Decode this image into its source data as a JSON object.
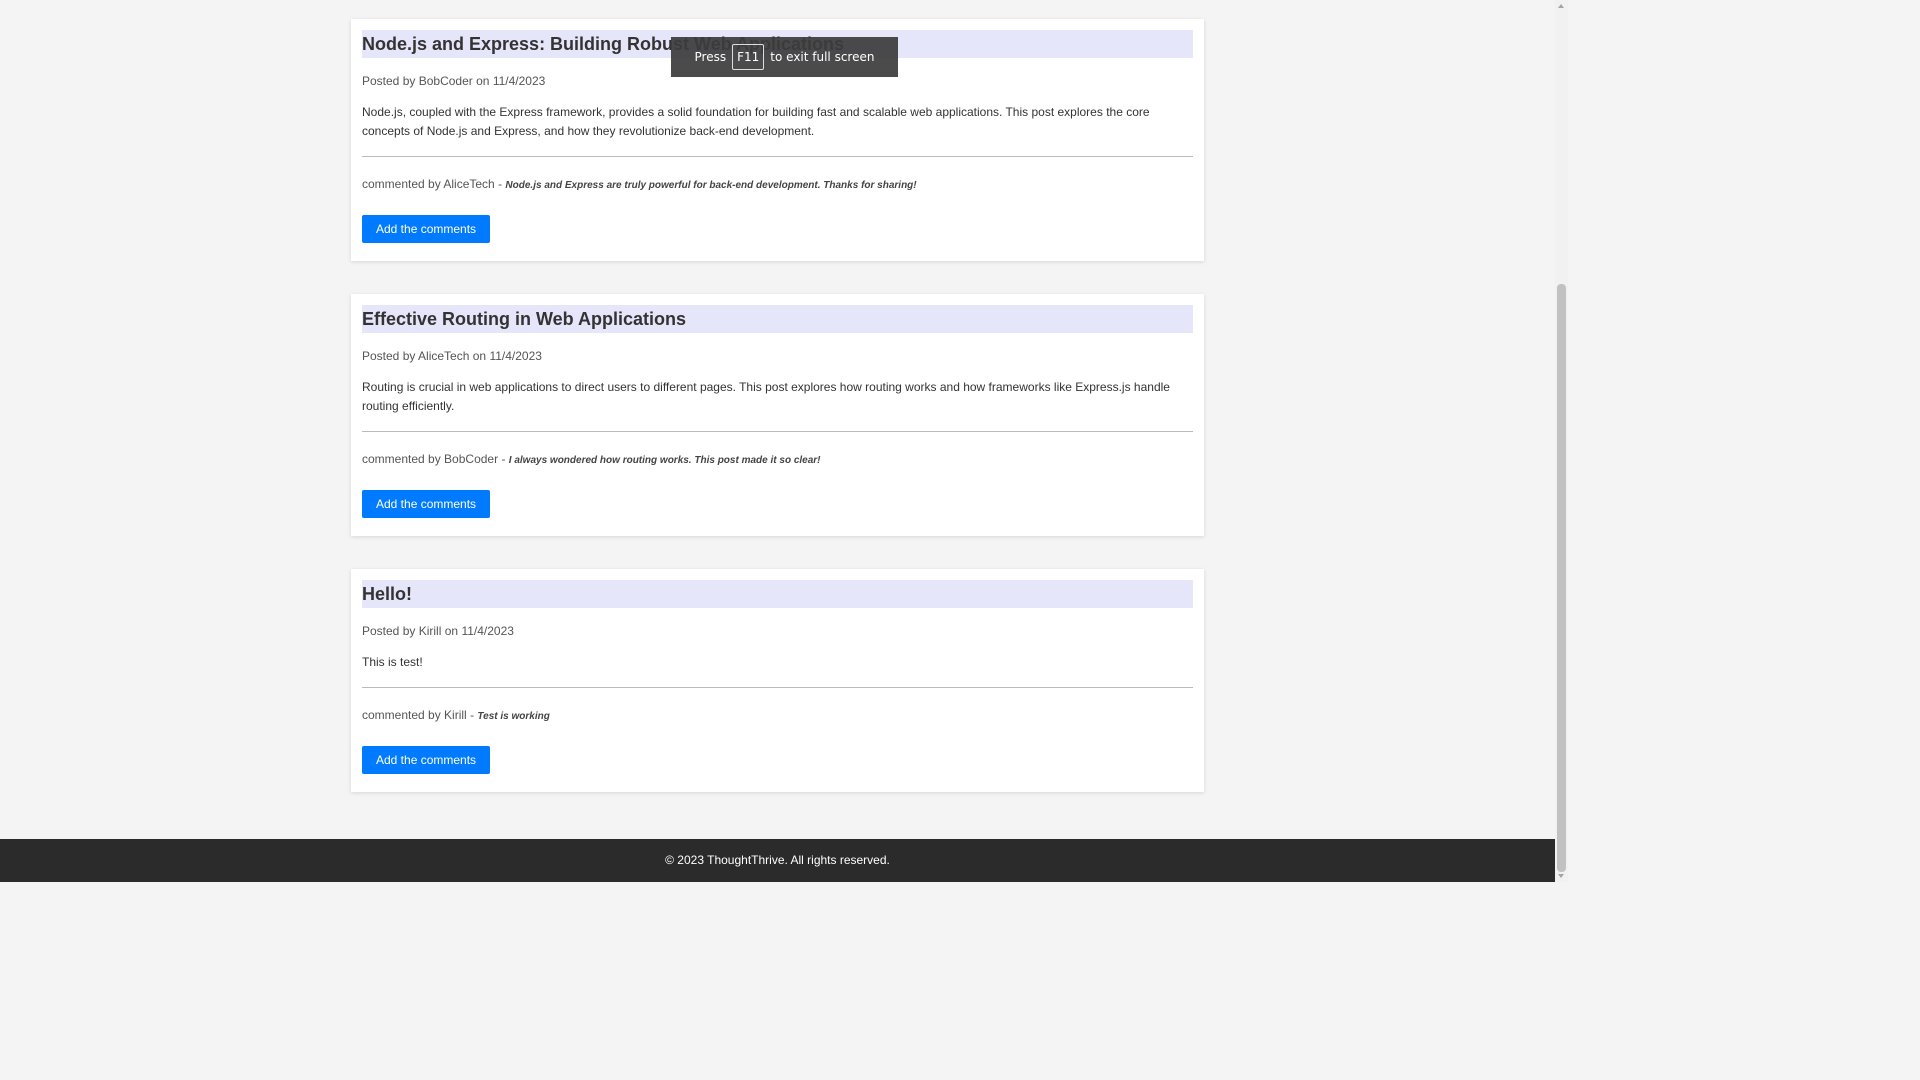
{
  "posts": [
    {
      "title": "Node.js and Express: Building Robust Web Applications",
      "posted_prefix": "Posted by",
      "author": "BobCoder",
      "on_word": "on",
      "date": "11/4/2023",
      "body": "Node.js, coupled with the Express framework, provides a solid foundation for building fast and scalable web applications. This post explores the core concepts of Node.js and Express, and how they revolutionize back-end development.",
      "comment_prefix": "commented by",
      "comment_author": "AliceTech",
      "comment_sep": "-",
      "comment_text": "Node.js and Express are truly powerful for back-end development. Thanks for sharing!",
      "button_label": "Add the comments"
    },
    {
      "title": "Effective Routing in Web Applications",
      "posted_prefix": "Posted by",
      "author": "AliceTech",
      "on_word": "on",
      "date": "11/4/2023",
      "body": "Routing is crucial in web applications to direct users to different pages. This post explores how routing works and how frameworks like Express.js handle routing efficiently.",
      "comment_prefix": "commented by",
      "comment_author": "BobCoder",
      "comment_sep": "-",
      "comment_text": "I always wondered how routing works. This post made it so clear!",
      "button_label": "Add the comments"
    },
    {
      "title": "Hello!",
      "posted_prefix": "Posted by",
      "author": "Kirill",
      "on_word": "on",
      "date": "11/4/2023",
      "body": "This is test!",
      "comment_prefix": "commented by",
      "comment_author": "Kirill",
      "comment_sep": "-",
      "comment_text": "Test is working",
      "button_label": "Add the comments"
    }
  ],
  "footer": {
    "text": "© 2023 ThoughtThrive. All rights reserved."
  },
  "fullscreen_toast": {
    "press": "Press",
    "key": "F11",
    "suffix": "to exit full screen"
  },
  "colors": {
    "title_bg": "#e6e6fa",
    "button_bg": "#007bff",
    "footer_bg": "#2b2b2b",
    "page_bg": "#f4f4f4"
  }
}
